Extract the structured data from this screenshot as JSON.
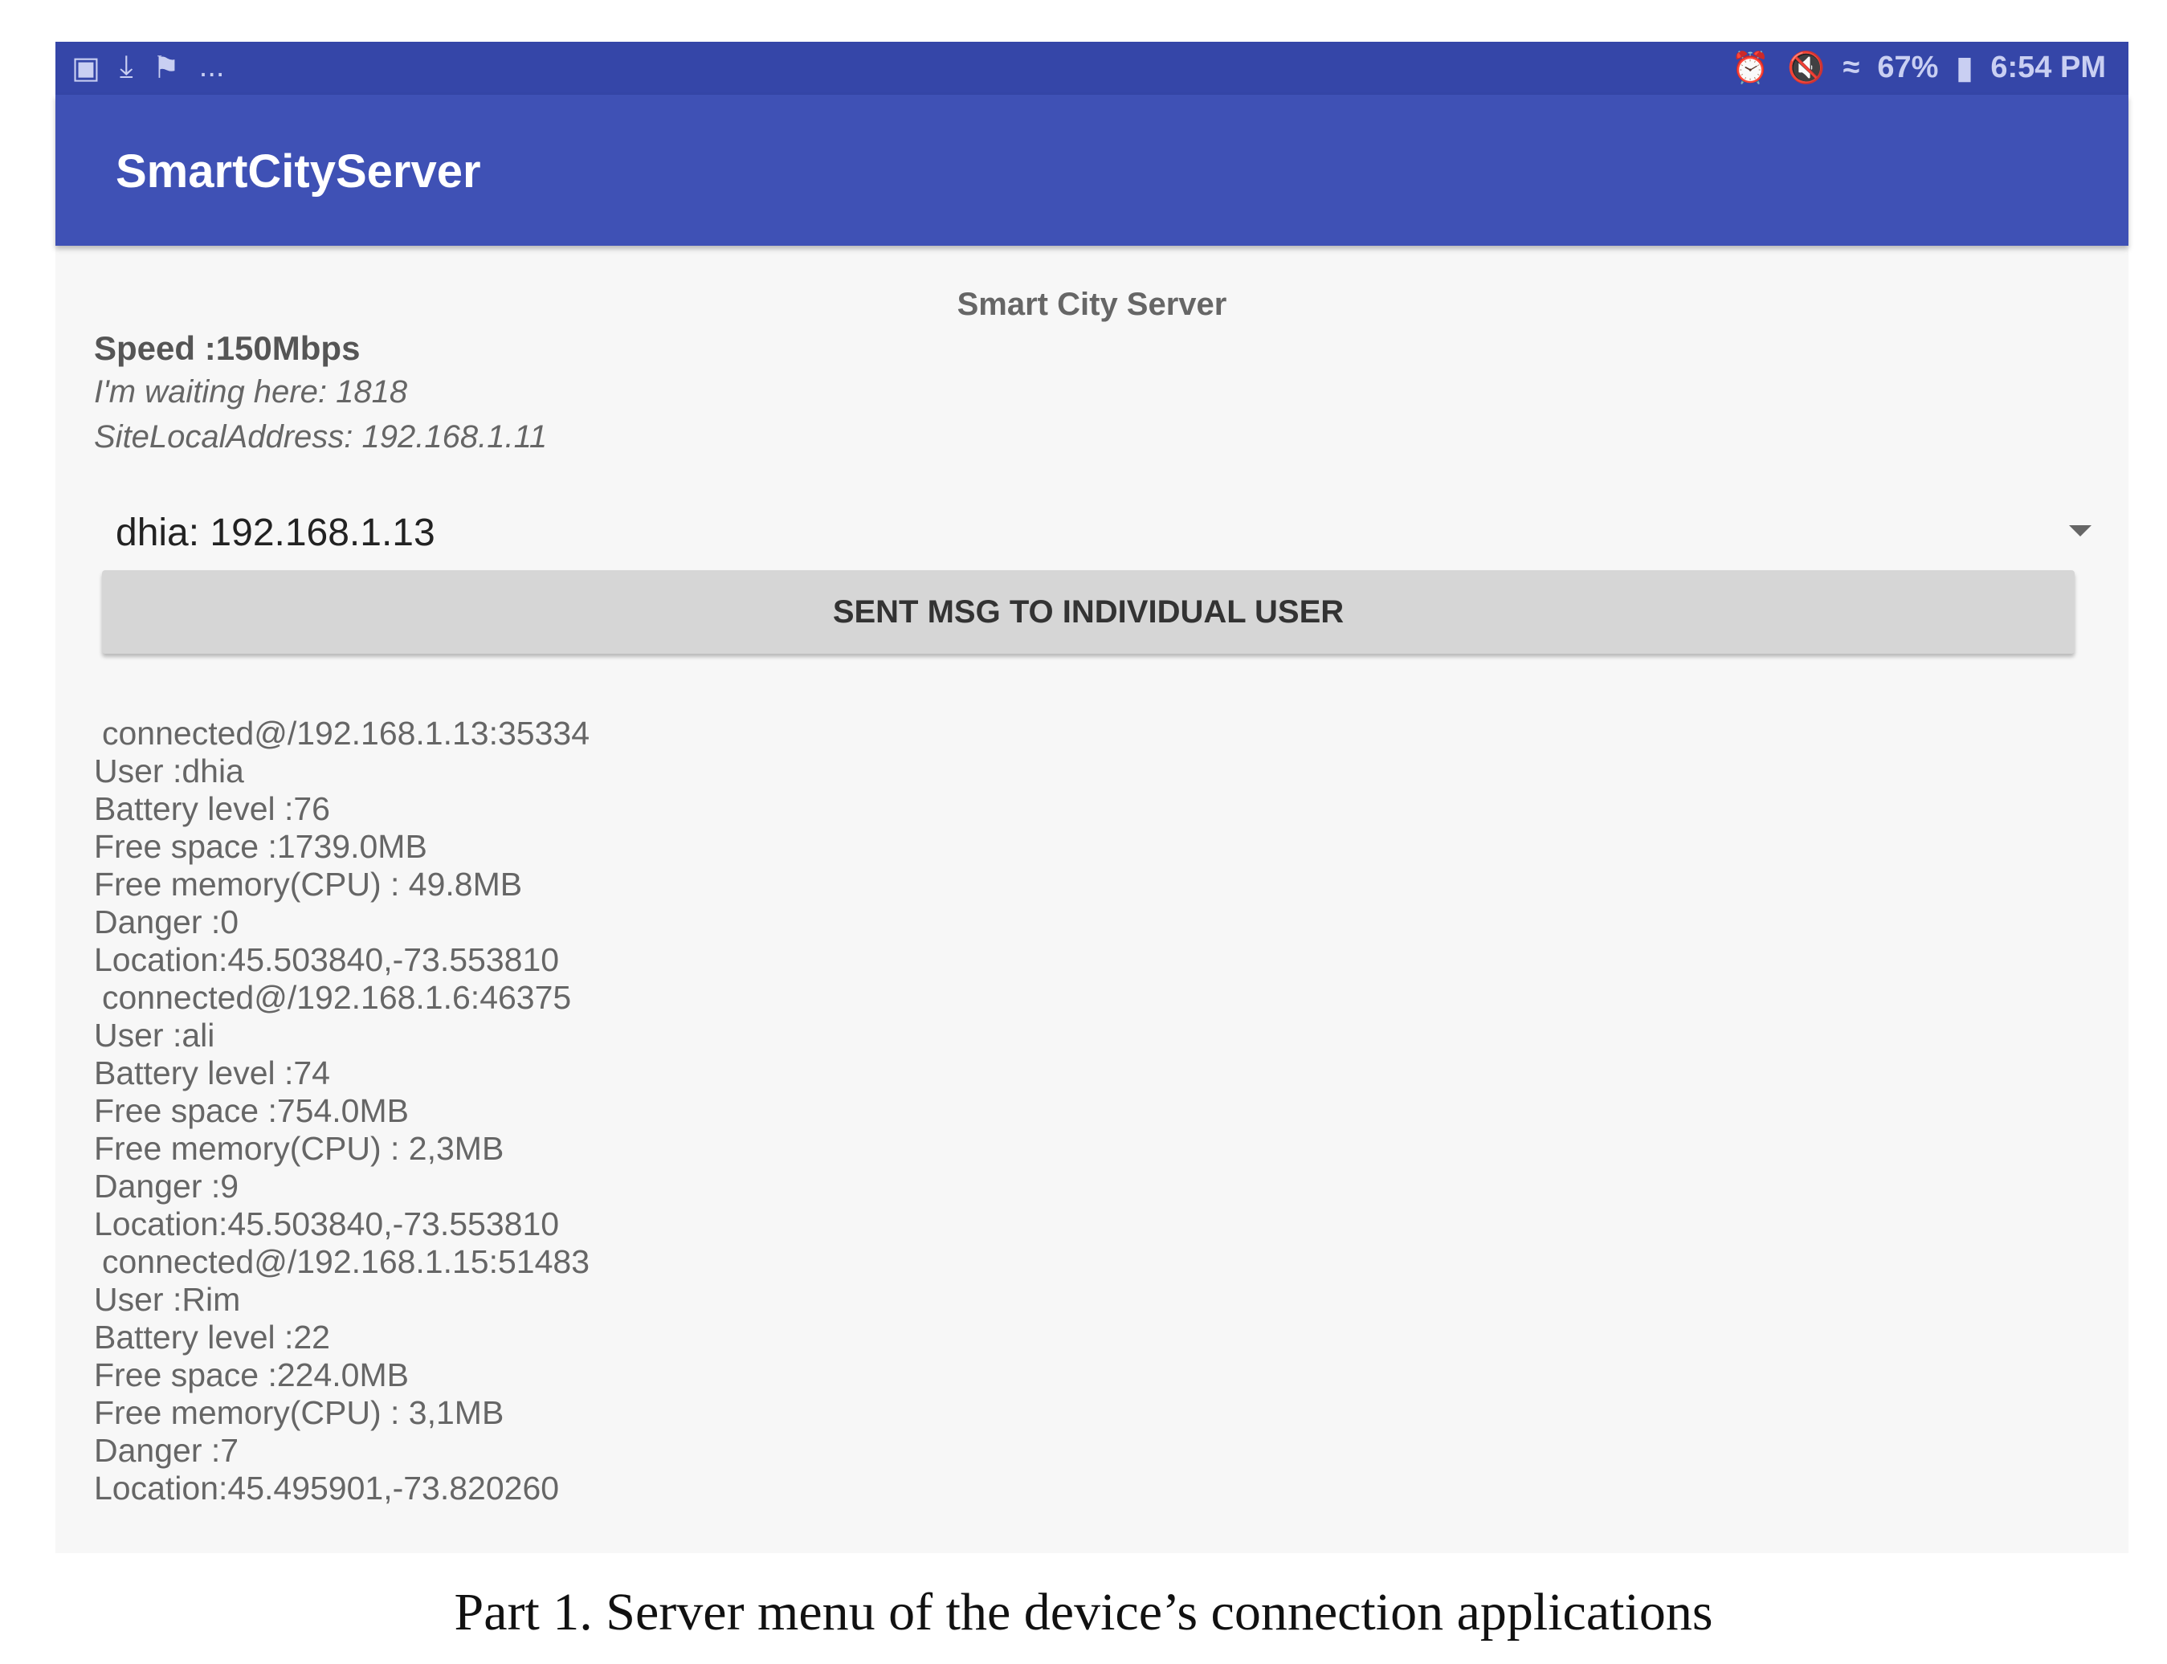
{
  "status_bar": {
    "left_icons": [
      "image-icon",
      "download-icon",
      "flag-icon"
    ],
    "more": "...",
    "battery_percent": "67%",
    "time": "6:54 PM"
  },
  "app_bar": {
    "title": "SmartCityServer"
  },
  "main": {
    "heading": "Smart City Server",
    "speed": "Speed :150Mbps",
    "waiting": "I'm waiting here: 1818",
    "site_local": "SiteLocalAddress: 192.168.1.11",
    "user_select": "dhia: 192.168.1.13",
    "send_button": "SENT MSG TO INDIVIDUAL USER",
    "log": [
      " connected@/192.168.1.13:35334",
      "User :dhia",
      "Battery level :76",
      "Free space :1739.0MB",
      "Free memory(CPU) : 49.8MB",
      "Danger :0",
      "Location:45.503840,-73.553810",
      " connected@/192.168.1.6:46375",
      "User :ali",
      "Battery level :74",
      "Free space :754.0MB",
      "Free memory(CPU) : 2,3MB",
      "Danger :9",
      "Location:45.503840,-73.553810",
      " connected@/192.168.1.15:51483",
      "User :Rim",
      "Battery level :22",
      "Free space :224.0MB",
      "Free memory(CPU) : 3,1MB",
      "Danger :7",
      "Location:45.495901,-73.820260"
    ]
  },
  "caption": "Part 1. Server menu of the device’s connection applications",
  "colors": {
    "status_bar": "#3546a8",
    "app_bar": "#3f51b5",
    "button": "#d6d6d6"
  }
}
